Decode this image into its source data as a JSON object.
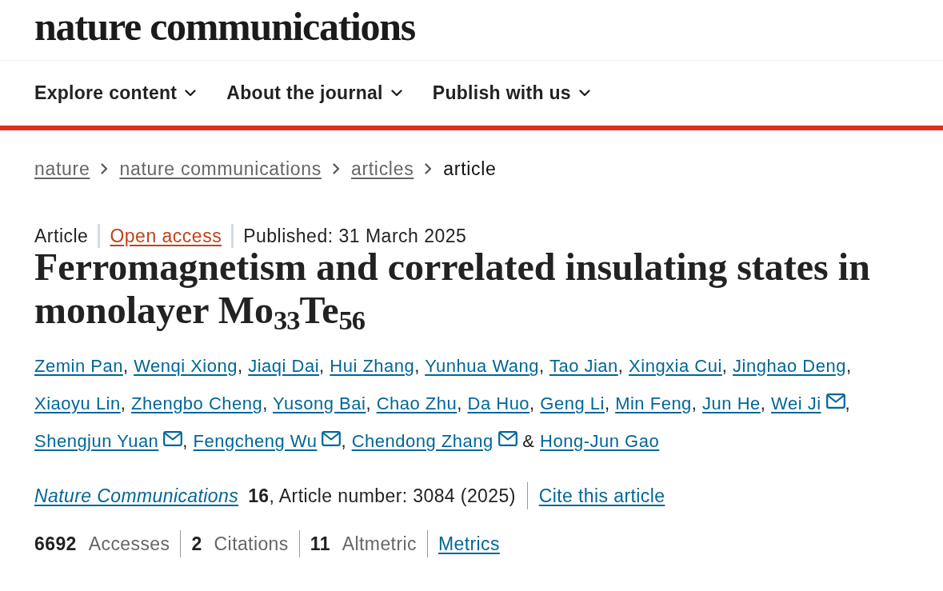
{
  "header": {
    "logo": "nature communications"
  },
  "nav": [
    {
      "label": "Explore content",
      "expanded": false
    },
    {
      "label": "About the journal",
      "expanded": false
    },
    {
      "label": "Publish with us",
      "expanded": false
    }
  ],
  "breadcrumbs": [
    {
      "label": "nature",
      "current": false
    },
    {
      "label": "nature communications",
      "current": false
    },
    {
      "label": "articles",
      "current": false
    },
    {
      "label": "article",
      "current": true
    }
  ],
  "article": {
    "type": "Article",
    "access": "Open access",
    "published": "Published: 31 March 2025",
    "title": "Ferromagnetism and correlated insulating states in monolayer Mo$_{33}$Te$_{56}$",
    "authors": [
      {
        "name": "Zemin Pan",
        "email": false,
        "separator": ", "
      },
      {
        "name": "Wenqi Xiong",
        "email": false,
        "separator": ", "
      },
      {
        "name": "Jiaqi Dai",
        "email": false,
        "separator": ", "
      },
      {
        "name": "Hui Zhang",
        "email": false,
        "separator": ", "
      },
      {
        "name": "Yunhua Wang",
        "email": false,
        "separator": ", "
      },
      {
        "name": "Tao Jian",
        "email": false,
        "separator": ", "
      },
      {
        "name": "Xingxia Cui",
        "email": false,
        "separator": ", "
      },
      {
        "name": "Jinghao Deng",
        "email": false,
        "separator": ", "
      },
      {
        "name": "Xiaoyu Lin",
        "email": false,
        "separator": ", "
      },
      {
        "name": "Zhengbo Cheng",
        "email": false,
        "separator": ", "
      },
      {
        "name": "Yusong Bai",
        "email": false,
        "separator": ", "
      },
      {
        "name": "Chao Zhu",
        "email": false,
        "separator": ", "
      },
      {
        "name": "Da Huo",
        "email": false,
        "separator": ", "
      },
      {
        "name": "Geng Li",
        "email": false,
        "separator": ", "
      },
      {
        "name": "Min Feng",
        "email": false,
        "separator": ", "
      },
      {
        "name": "Jun He",
        "email": false,
        "separator": ", "
      },
      {
        "name": "Wei Ji",
        "email": true,
        "separator": ", "
      },
      {
        "name": "Shengjun Yuan",
        "email": true,
        "separator": ", "
      },
      {
        "name": "Fengcheng Wu",
        "email": true,
        "separator": ", "
      },
      {
        "name": "Chendong Zhang",
        "email": true,
        "separator": " & "
      },
      {
        "name": "Hong-Jun Gao",
        "email": false
      }
    ],
    "citation": {
      "journal": "Nature Communications",
      "details": "**16**, Article number: 3084 (2025)",
      "cite_link": "Cite this article"
    },
    "metrics": [
      {
        "count": "6692",
        "label": "Accesses"
      },
      {
        "count": "2",
        "label": "Citations"
      },
      {
        "count": "11",
        "label": "Altmetric"
      }
    ],
    "metrics_link": "Metrics"
  }
}
